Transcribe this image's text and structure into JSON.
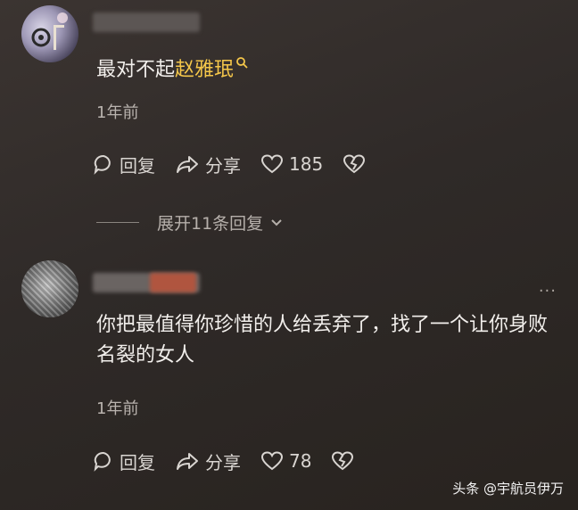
{
  "comments": [
    {
      "text_prefix": "最对不起",
      "mention": "赵雅珉",
      "time": "1年前",
      "reply_label": "回复",
      "share_label": "分享",
      "like_count": "185"
    },
    {
      "text": "你把最值得你珍惜的人给丢弃了，找了一个让你身败名裂的女人",
      "time": "1年前",
      "reply_label": "回复",
      "share_label": "分享",
      "like_count": "78"
    }
  ],
  "expand_replies": "展开11条回复",
  "more_menu": "···",
  "watermark": "头条 @宇航员伊万"
}
